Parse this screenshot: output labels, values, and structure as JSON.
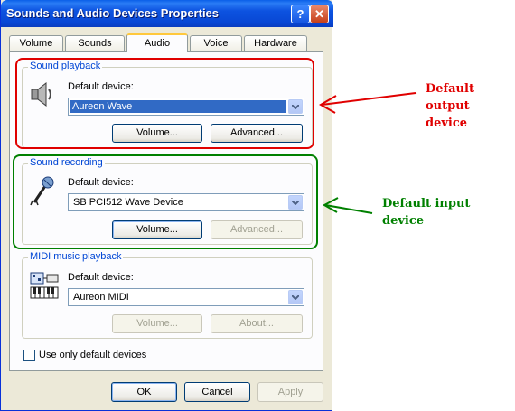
{
  "window": {
    "title": "Sounds and Audio Devices Properties",
    "help_label": "?",
    "close_label": "✕"
  },
  "tabs": [
    {
      "label": "Volume"
    },
    {
      "label": "Sounds"
    },
    {
      "label": "Audio",
      "active": true
    },
    {
      "label": "Voice"
    },
    {
      "label": "Hardware"
    }
  ],
  "playback": {
    "group_label": "Sound playback",
    "icon": "speaker-icon",
    "device_label": "Default device:",
    "device_value": "Aureon Wave",
    "volume_button": "Volume...",
    "advanced_button": "Advanced..."
  },
  "recording": {
    "group_label": "Sound recording",
    "icon": "microphone-icon",
    "device_label": "Default device:",
    "device_value": "SB PCI512 Wave Device",
    "volume_button": "Volume...",
    "advanced_button": "Advanced..."
  },
  "midi": {
    "group_label": "MIDI music playback",
    "icon": "midi-keyboard-icon",
    "device_label": "Default device:",
    "device_value": "Aureon MIDI",
    "volume_button": "Volume...",
    "about_button": "About..."
  },
  "checkbox": {
    "label": "Use only default devices",
    "checked": false
  },
  "footer": {
    "ok": "OK",
    "cancel": "Cancel",
    "apply": "Apply"
  },
  "annotations": {
    "output_line1": "Default output",
    "output_line2": "device",
    "input_line1": "Default input",
    "input_line2": "device",
    "output_color": "#e00000",
    "input_color": "#008000"
  },
  "colors": {
    "titlebar": "#0a54e0",
    "selection": "#316ac5",
    "group_label": "#0046d5"
  }
}
